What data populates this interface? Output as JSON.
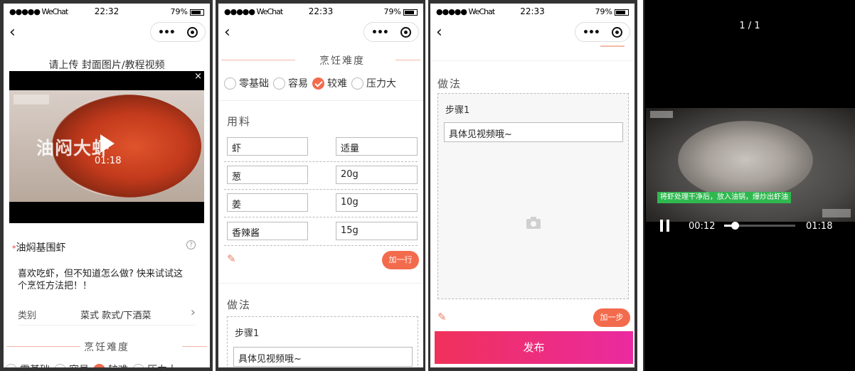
{
  "status": {
    "signal": "●●●●● WeChat",
    "battery": "79%",
    "time1": "22:32",
    "time2": "22:33",
    "time3": "22:33"
  },
  "p1": {
    "upload_title": "请上传 封面图片/教程视频",
    "video_title": "油闷大虾",
    "video_duration": "01:18",
    "close": "×",
    "dish_name": "油焖基围虾",
    "required_mark": "*",
    "help": "?",
    "description": "喜欢吃虾，但不知道怎么做? 快来试试这个烹饪方法把！！",
    "category_label": "类别",
    "category_value": "菜式 款式/下酒菜",
    "difficulty_title": "烹饪难度"
  },
  "p2": {
    "difficulty_title": "烹饪难度",
    "difficulty_options": [
      "零基础",
      "容易",
      "较难",
      "压力大"
    ],
    "ingredients_title": "用料",
    "ingredients": [
      {
        "name": "虾",
        "amount": "适量"
      },
      {
        "name": "葱",
        "amount": "20g"
      },
      {
        "name": "姜",
        "amount": "10g"
      },
      {
        "name": "香辣酱",
        "amount": "15g"
      }
    ],
    "add_row": "加一行",
    "method_title": "做法",
    "step_label": "步骤1",
    "step_text": "具体见视频哦~"
  },
  "p3": {
    "method_title": "做法",
    "step_label": "步骤1",
    "step_text": "具体见视频哦~",
    "add_step": "加一步",
    "publish": "发布"
  },
  "p4": {
    "page_counter": "1 / 1",
    "subtitle": "将虾处理干净后，放入油锅，爆炒出虾油",
    "current_time": "00:12",
    "duration": "01:18",
    "progress": 0.15
  },
  "colors": {
    "accent": "#f36b4d",
    "publish_start": "#f0315a",
    "publish_end": "#ea2aa0",
    "subtitle_bg": "#2fb84f"
  },
  "icons": [
    "back-icon",
    "more-icon",
    "record-icon",
    "play-icon",
    "close-icon",
    "help-icon",
    "chevron-right-icon",
    "check-icon",
    "pencil-icon",
    "camera-icon",
    "pause-icon"
  ]
}
